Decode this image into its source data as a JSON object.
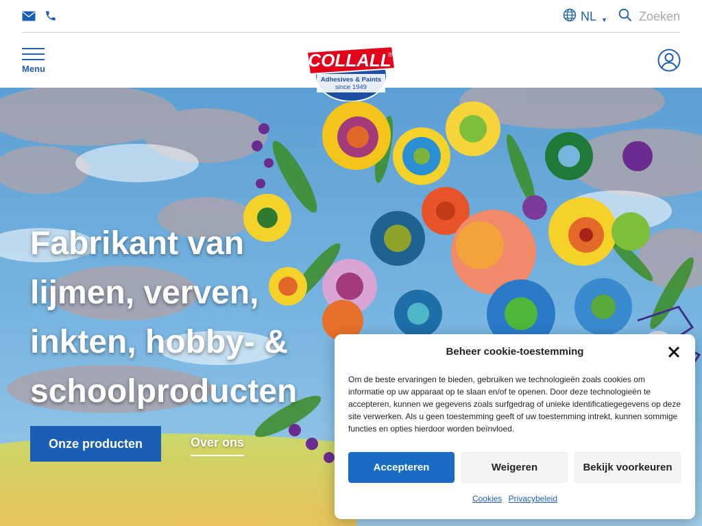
{
  "topbar": {
    "mail_icon": "mail-icon",
    "phone_icon": "phone-icon",
    "language": "NL",
    "search_placeholder": "Zoeken"
  },
  "header": {
    "menu_label": "Menu",
    "logo": {
      "brand": "COLLALL",
      "registered": "®",
      "tagline": "Adhesives & Paints",
      "since": "since 1949"
    },
    "account_icon": "user-icon"
  },
  "hero": {
    "title": "Fabrikant van lijmen, verven, inkten, hobby- & schoolproducten",
    "primary_button": "Onze producten",
    "secondary_link": "Over ons"
  },
  "cookie": {
    "title": "Beheer cookie-toestemming",
    "text": "Om de beste ervaringen te bieden, gebruiken we technologieën zoals cookies om informatie op uw apparaat op te slaan en/of te openen. Door deze technologieën te accepteren, kunnen we gegevens zoals surfgedrag of unieke identificatiegegevens op deze site verwerken. Als u geen toestemming geeft of uw toestemming intrekt, kunnen sommige functies en opties hierdoor worden beïnvloed.",
    "accept": "Accepteren",
    "deny": "Weigeren",
    "preferences": "Bekijk voorkeuren",
    "links": [
      "Cookies",
      "Privacybeleid"
    ]
  },
  "colors": {
    "brand_blue": "#1a5fb4",
    "logo_red": "#e2001a",
    "accept_blue": "#1a6bc4"
  }
}
